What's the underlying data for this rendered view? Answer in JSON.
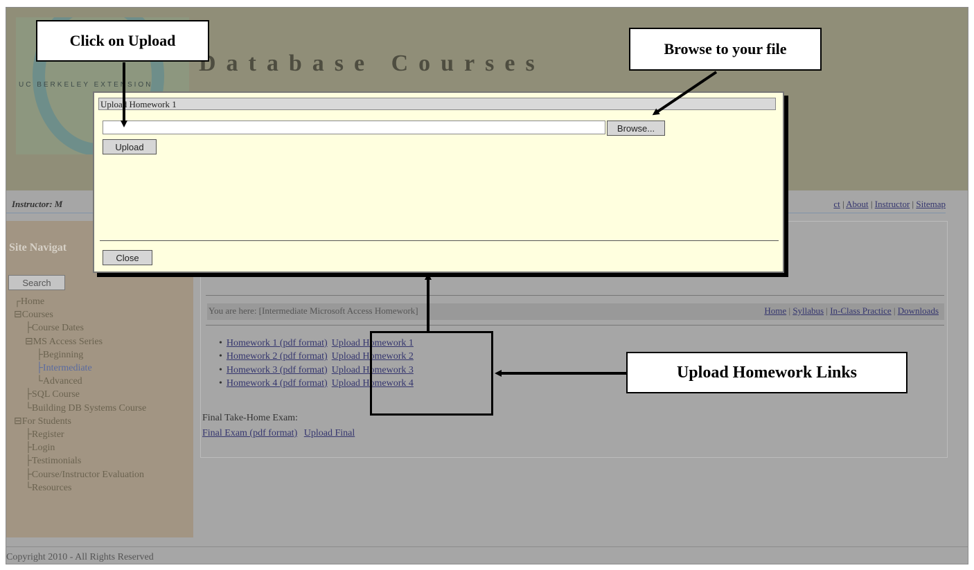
{
  "banner": {
    "seal_text": "UC BERKELEY EXTENSION",
    "site_title": "Database Courses"
  },
  "instructor_bar": {
    "label": "Instructor: M",
    "top_links": [
      "ct",
      "About",
      "Instructor",
      "Sitemap"
    ]
  },
  "sidebar": {
    "heading": "Site Navigat",
    "search_label": "Search",
    "tree": [
      {
        "label": "Home",
        "prefix": "┌",
        "level": 1
      },
      {
        "label": "Courses",
        "prefix": "⊟",
        "level": 1
      },
      {
        "label": "Course Dates",
        "prefix": "├",
        "level": 2
      },
      {
        "label": "MS Access Series",
        "prefix": "⊟",
        "level": 2
      },
      {
        "label": "Beginning",
        "prefix": "├",
        "level": 3
      },
      {
        "label": "Intermediate",
        "prefix": "├",
        "level": 3,
        "active": true
      },
      {
        "label": "Advanced",
        "prefix": "└",
        "level": 3
      },
      {
        "label": "SQL Course",
        "prefix": "├",
        "level": 2
      },
      {
        "label": "Building DB Systems Course",
        "prefix": "└",
        "level": 2
      },
      {
        "label": "For Students",
        "prefix": "⊟",
        "level": 1
      },
      {
        "label": "Register",
        "prefix": "├",
        "level": 2
      },
      {
        "label": "Login",
        "prefix": "├",
        "level": 2
      },
      {
        "label": "Testimonials",
        "prefix": "├",
        "level": 2
      },
      {
        "label": "Course/Instructor Evaluation",
        "prefix": "├",
        "level": 2
      },
      {
        "label": "Resources",
        "prefix": "└",
        "level": 2
      }
    ]
  },
  "content": {
    "breadcrumb": "You are here: [Intermediate Microsoft Access Homework]",
    "crumb_links": [
      "Home",
      "Syllabus",
      "In-Class Practice",
      "Downloads"
    ],
    "homework": [
      {
        "pdf": "Homework 1 (pdf format)",
        "upload": "Upload Homework 1"
      },
      {
        "pdf": "Homework 2 (pdf format)",
        "upload": "Upload Homework 2"
      },
      {
        "pdf": "Homework 3 (pdf format)",
        "upload": "Upload Homework 3"
      },
      {
        "pdf": "Homework 4 (pdf format)",
        "upload": "Upload Homework 4"
      }
    ],
    "final_label": "Final Take-Home Exam:",
    "final_pdf": "Final Exam (pdf format)",
    "final_upload": "Upload Final"
  },
  "dialog": {
    "title": "Upload Homework 1",
    "file_value": "",
    "browse_label": "Browse...",
    "upload_label": "Upload",
    "close_label": "Close"
  },
  "annotations": {
    "click_upload": "Click on Upload",
    "browse_file": "Browse to your file",
    "upload_links": "Upload Homework Links"
  },
  "footer": {
    "copyright": "Copyright 2010 - All Rights Reserved"
  }
}
